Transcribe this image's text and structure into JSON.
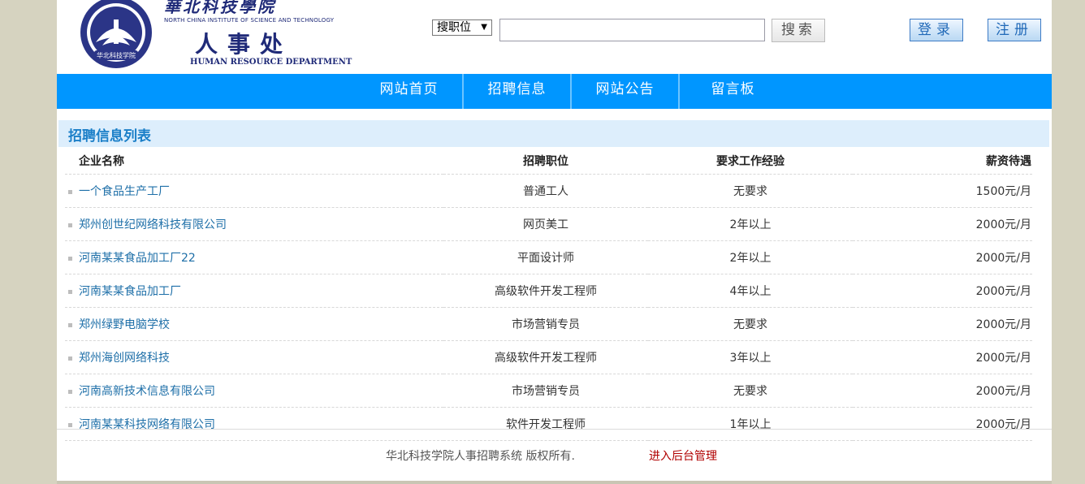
{
  "header": {
    "brand_cn": "華北科技學院",
    "brand_en": "NORTH CHINA INSTITUTE OF SCIENCE AND TECHNOLOGY",
    "dept_cn": "人事处",
    "dept_en": "HUMAN RESOURCE DEPARTMENT",
    "logo_text": "华北科技学院"
  },
  "search": {
    "type_selected": "搜职位",
    "input_value": "",
    "button_label": "搜索"
  },
  "auth": {
    "login_label": "登录",
    "register_label": "注册"
  },
  "nav": {
    "items": [
      "网站首页",
      "招聘信息",
      "网站公告",
      "留言板"
    ]
  },
  "list": {
    "title": "招聘信息列表",
    "columns": [
      "企业名称",
      "招聘职位",
      "要求工作经验",
      "薪资待遇"
    ],
    "rows": [
      {
        "company": "一个食品生产工厂",
        "position": "普通工人",
        "experience": "无要求",
        "salary": "1500元/月"
      },
      {
        "company": "郑州创世纪网络科技有限公司",
        "position": "网页美工",
        "experience": "2年以上",
        "salary": "2000元/月"
      },
      {
        "company": "河南某某食品加工厂22",
        "position": "平面设计师",
        "experience": "2年以上",
        "salary": "2000元/月"
      },
      {
        "company": "河南某某食品加工厂",
        "position": "高级软件开发工程师",
        "experience": "4年以上",
        "salary": "2000元/月"
      },
      {
        "company": "郑州绿野电脑学校",
        "position": "市场营销专员",
        "experience": "无要求",
        "salary": "2000元/月"
      },
      {
        "company": "郑州海创网络科技",
        "position": "高级软件开发工程师",
        "experience": "3年以上",
        "salary": "2000元/月"
      },
      {
        "company": "河南高新技术信息有限公司",
        "position": "市场营销专员",
        "experience": "无要求",
        "salary": "2000元/月"
      },
      {
        "company": "河南某某科技网络有限公司",
        "position": "软件开发工程师",
        "experience": "1年以上",
        "salary": "2000元/月"
      }
    ]
  },
  "footer": {
    "copyright": "华北科技学院人事招聘系统 版权所有.",
    "admin_link": "进入后台管理"
  },
  "colors": {
    "nav_bg": "#0096ff",
    "title_bar_bg": "#ddeefc",
    "brand": "#1f2a78",
    "link": "#1e6fa8",
    "admin_link": "#b00000"
  }
}
